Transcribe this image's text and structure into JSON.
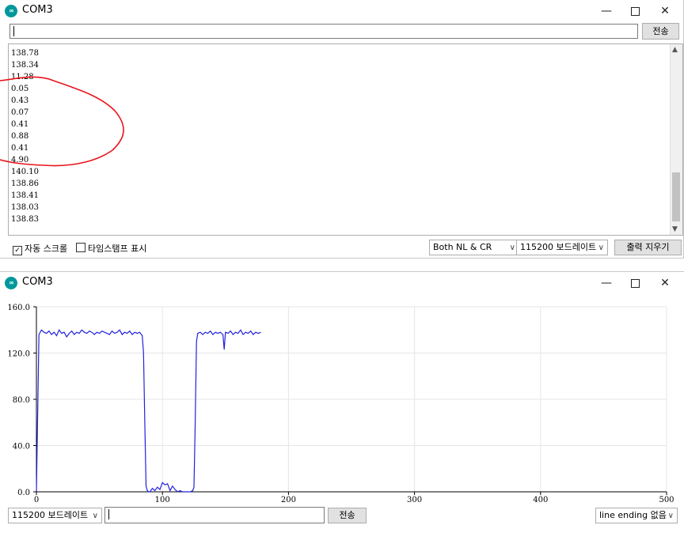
{
  "monitor": {
    "title": "COM3",
    "window_controls": {
      "minimize": "—",
      "close": "✕"
    },
    "send_button": "전송",
    "output_lines": [
      "138.78",
      "138.34",
      "11.28",
      "0.05",
      "0.43",
      "0.07",
      "0.41",
      "0.88",
      "0.41",
      "4.90",
      "140.10",
      "138.86",
      "138.41",
      "138.03",
      "138.83"
    ],
    "autoscroll_label": "자동 스크롤",
    "autoscroll_checked": true,
    "timestamp_label": "타임스탬프 표시",
    "timestamp_checked": false,
    "line_ending": "Both NL & CR",
    "baud": "115200 보드레이트",
    "clear_button": "출력 지우기",
    "annotation_color": "#e8141c"
  },
  "plotter": {
    "title": "COM3",
    "window_controls": {
      "minimize": "—",
      "close": "✕"
    },
    "baud": "115200 보드레이트",
    "send_button": "전송",
    "line_ending": "line ending 없음",
    "input_value": ""
  },
  "chart_data": {
    "type": "line",
    "title": "",
    "xlabel": "",
    "ylabel": "",
    "xlim": [
      0,
      500
    ],
    "ylim": [
      0,
      160
    ],
    "x_ticks": [
      "0",
      "100",
      "200",
      "300",
      "400",
      "500"
    ],
    "y_ticks": [
      "0.0",
      "40.0",
      "80.0",
      "120.0",
      "160.0"
    ],
    "grid": true,
    "line_color": "#2222dd",
    "series": [
      {
        "x": [
          0,
          2,
          4,
          6,
          8,
          10,
          12,
          14,
          16,
          18,
          20,
          22,
          24,
          26,
          28,
          30,
          32,
          34,
          36,
          38,
          40,
          42,
          44,
          46,
          48,
          50,
          52,
          54,
          56,
          58,
          60,
          62,
          64,
          66,
          68,
          70,
          72,
          74,
          76,
          78,
          80,
          82,
          84,
          85,
          86,
          87,
          88,
          89,
          90,
          92,
          94,
          96,
          98,
          100,
          102,
          104,
          106,
          108,
          110,
          112,
          114,
          116,
          118,
          120,
          122,
          124,
          125,
          126,
          127,
          128,
          130,
          132,
          134,
          136,
          138,
          140,
          142,
          144,
          146,
          148,
          149,
          150,
          152,
          154,
          156,
          158,
          160,
          162,
          164,
          166,
          168,
          170,
          172,
          174,
          176,
          178
        ],
        "y": [
          0,
          136,
          140,
          138,
          137,
          139,
          136,
          138,
          135,
          140,
          137,
          138,
          134,
          137,
          139,
          136,
          138,
          137,
          140,
          138,
          137,
          139,
          138,
          136,
          138,
          137,
          139,
          138,
          137,
          136,
          139,
          137,
          138,
          140,
          136,
          138,
          137,
          139,
          136,
          138,
          137,
          138,
          135,
          120,
          60,
          5,
          1,
          0,
          0,
          3,
          1,
          4,
          2,
          8,
          6,
          7,
          1,
          5,
          2,
          0,
          1,
          0,
          0,
          0,
          0,
          1,
          4,
          60,
          130,
          137,
          138,
          136,
          138,
          137,
          139,
          136,
          138,
          137,
          138,
          136,
          123,
          138,
          137,
          139,
          136,
          138,
          137,
          140,
          136,
          138,
          137,
          139,
          136,
          138,
          137,
          138
        ]
      }
    ]
  }
}
